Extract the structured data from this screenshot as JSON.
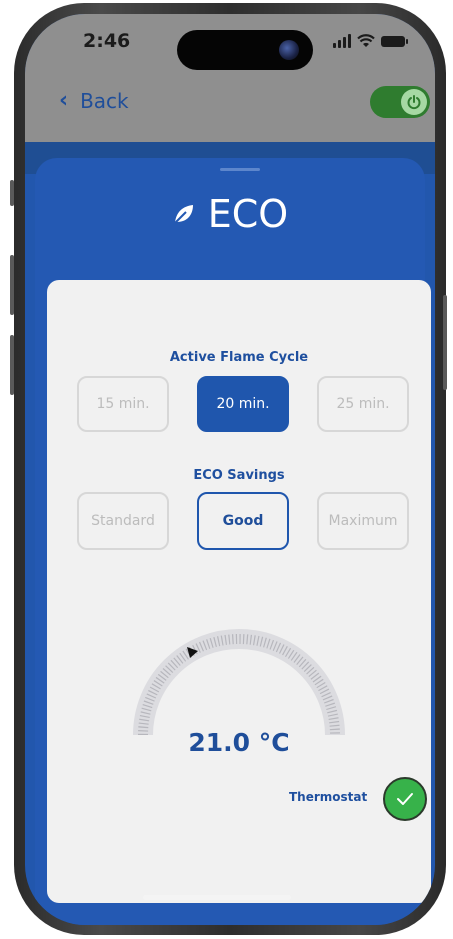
{
  "status": {
    "time": "2:46"
  },
  "nav": {
    "back_label": "Back"
  },
  "header": {
    "title": "ECO",
    "icon": "leaf-icon"
  },
  "active_flame_cycle": {
    "label": "Active Flame Cycle",
    "options": [
      "15 min.",
      "20 min.",
      "25 min."
    ],
    "selected": "20 min."
  },
  "eco_savings": {
    "label": "ECO Savings",
    "options": [
      "Standard",
      "Good",
      "Maximum"
    ],
    "selected": "Good"
  },
  "temperature": {
    "value_text": "21.0 °C",
    "value": 21.0
  },
  "thermostat": {
    "label": "Thermostat",
    "enabled": true
  },
  "colors": {
    "accent_blue": "#1f56ad",
    "sheet_blue": "#2459b3",
    "power_green": "#2f7c2f",
    "check_green": "#37b24a"
  }
}
